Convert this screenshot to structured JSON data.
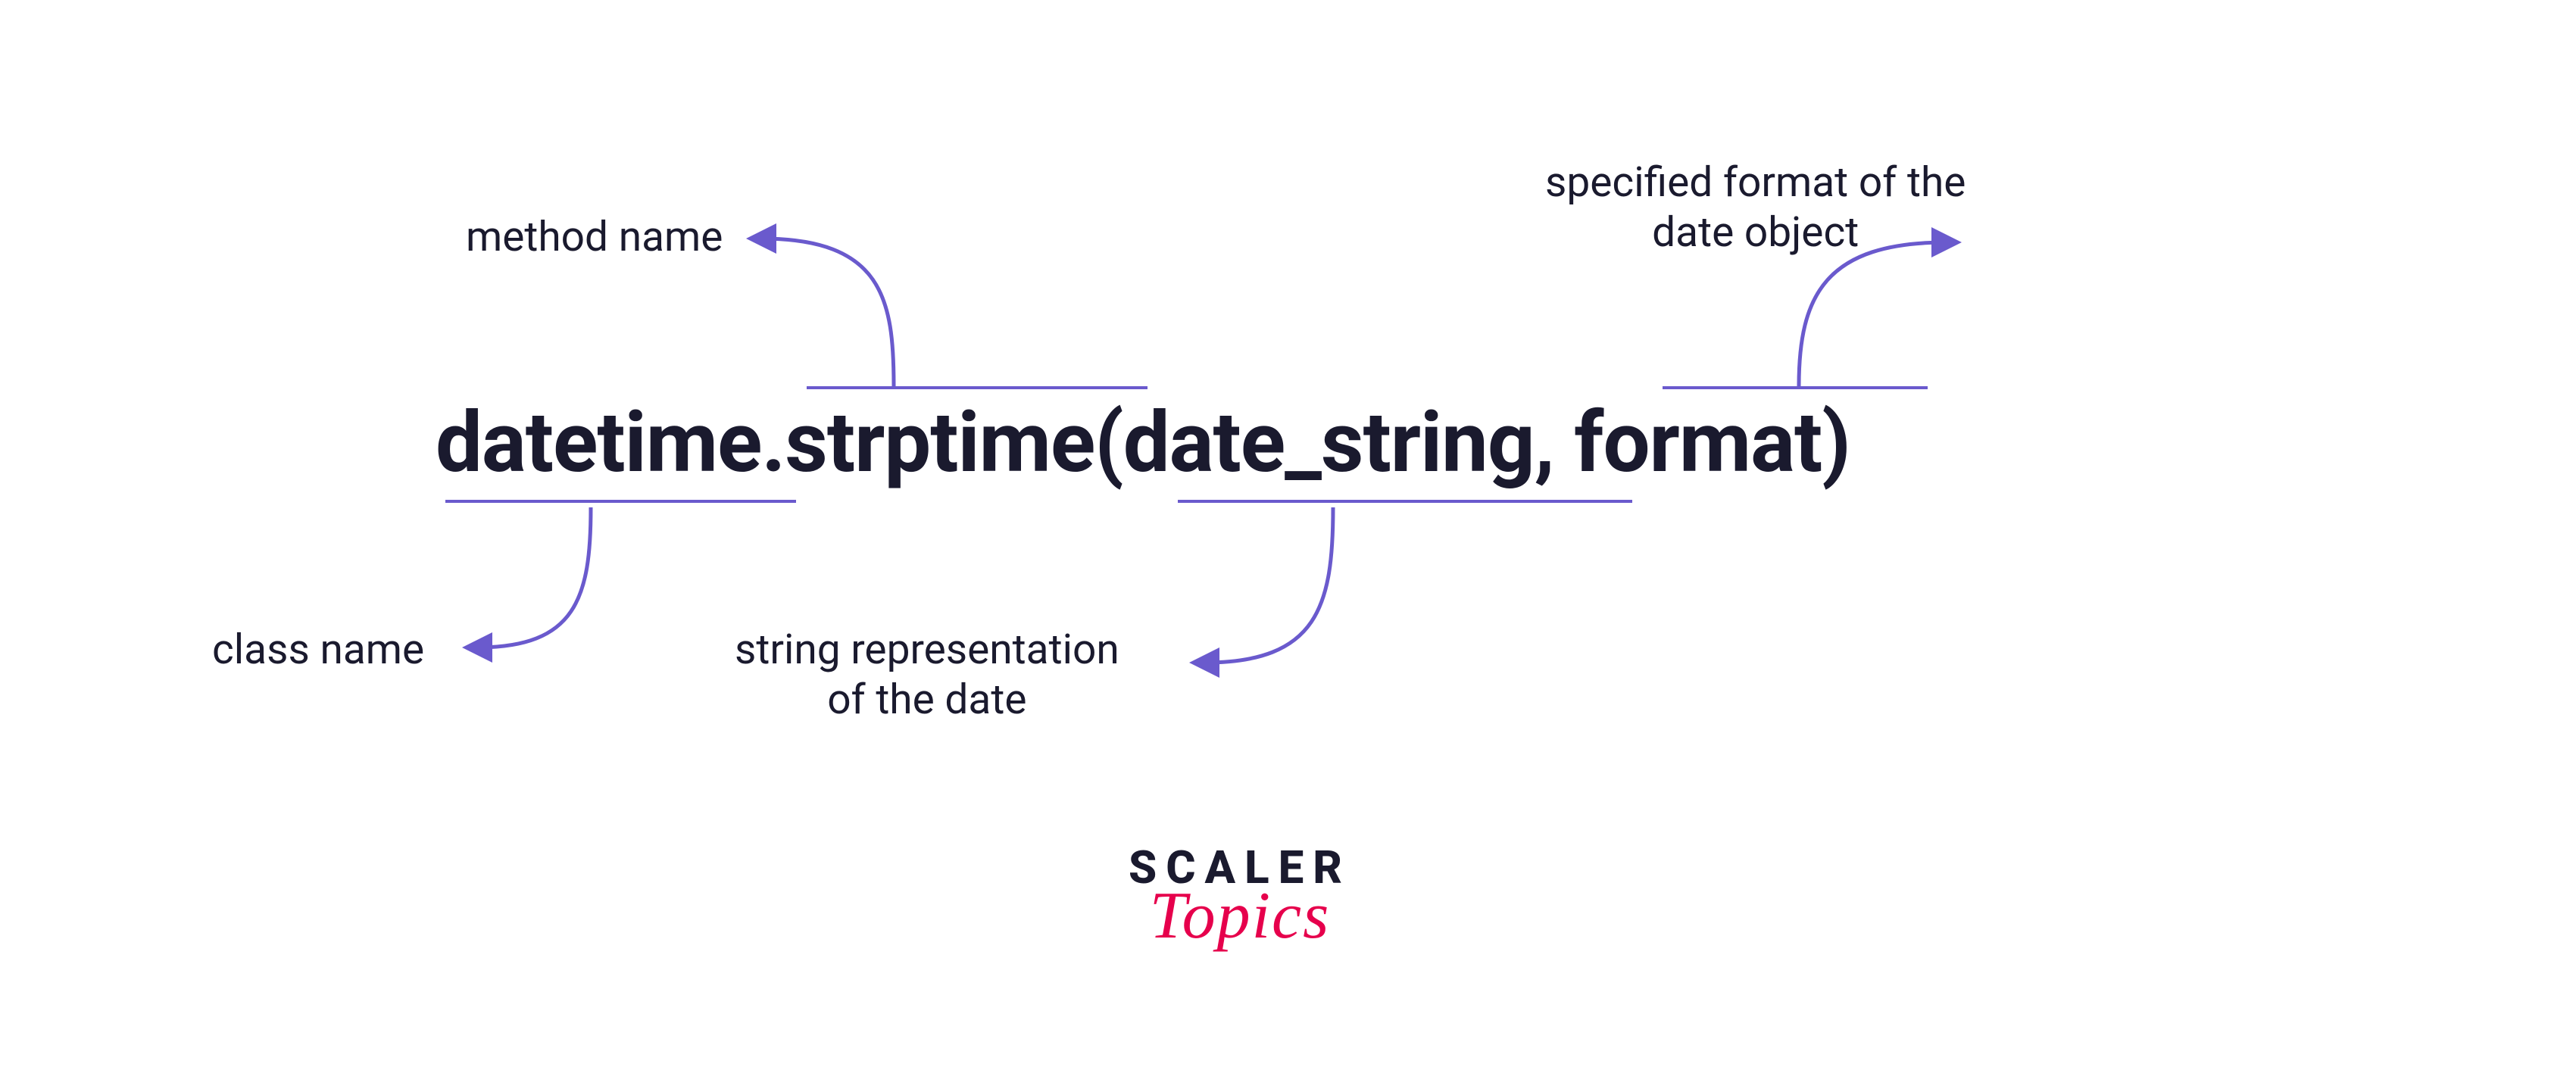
{
  "expression": {
    "full": "datetime.strptime(date_string, format)",
    "parts": {
      "class_name": "datetime",
      "method_name": "strptime",
      "arg1": "date_string",
      "arg2": "format"
    }
  },
  "labels": {
    "method_name": "method name",
    "class_name": "class name",
    "string_repr_line1": "string representation",
    "string_repr_line2": "of the date",
    "format_line1": "specified format of the",
    "format_line2": "date object"
  },
  "logo": {
    "line1": "SCALER",
    "line2": "Topics"
  },
  "colors": {
    "arrow": "#6a5acd",
    "text_dark": "#1a1a2e",
    "accent_pink": "#e6004c"
  }
}
